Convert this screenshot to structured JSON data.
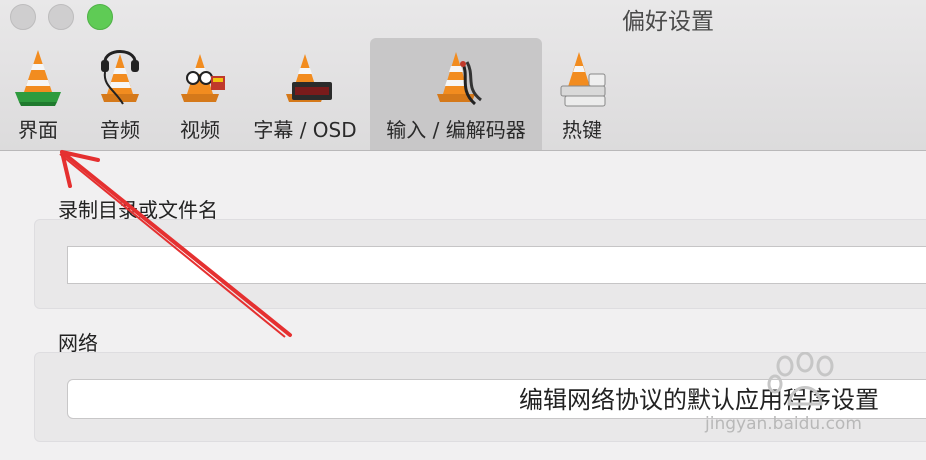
{
  "window": {
    "title": "偏好设置"
  },
  "toolbar": {
    "tabs": [
      {
        "label": "界面",
        "icon": "vlc-interface-icon"
      },
      {
        "label": "音频",
        "icon": "vlc-audio-icon"
      },
      {
        "label": "视频",
        "icon": "vlc-video-icon"
      },
      {
        "label": "字幕 / OSD",
        "icon": "vlc-subtitles-icon"
      },
      {
        "label": "输入 / 编解码器",
        "icon": "vlc-input-codecs-icon",
        "selected": true
      },
      {
        "label": "热键",
        "icon": "vlc-hotkeys-icon"
      }
    ]
  },
  "record": {
    "label": "录制目录或文件名",
    "value": ""
  },
  "network": {
    "label": "网络",
    "button_label": "编辑网络协议的默认应用程序设置"
  },
  "watermark": {
    "text": "jingyan.baidu.com"
  },
  "colors": {
    "annotation_arrow": "#e53030",
    "active_tab_bg": "#c8c7c8",
    "zoom_button": "#5fcb55"
  }
}
